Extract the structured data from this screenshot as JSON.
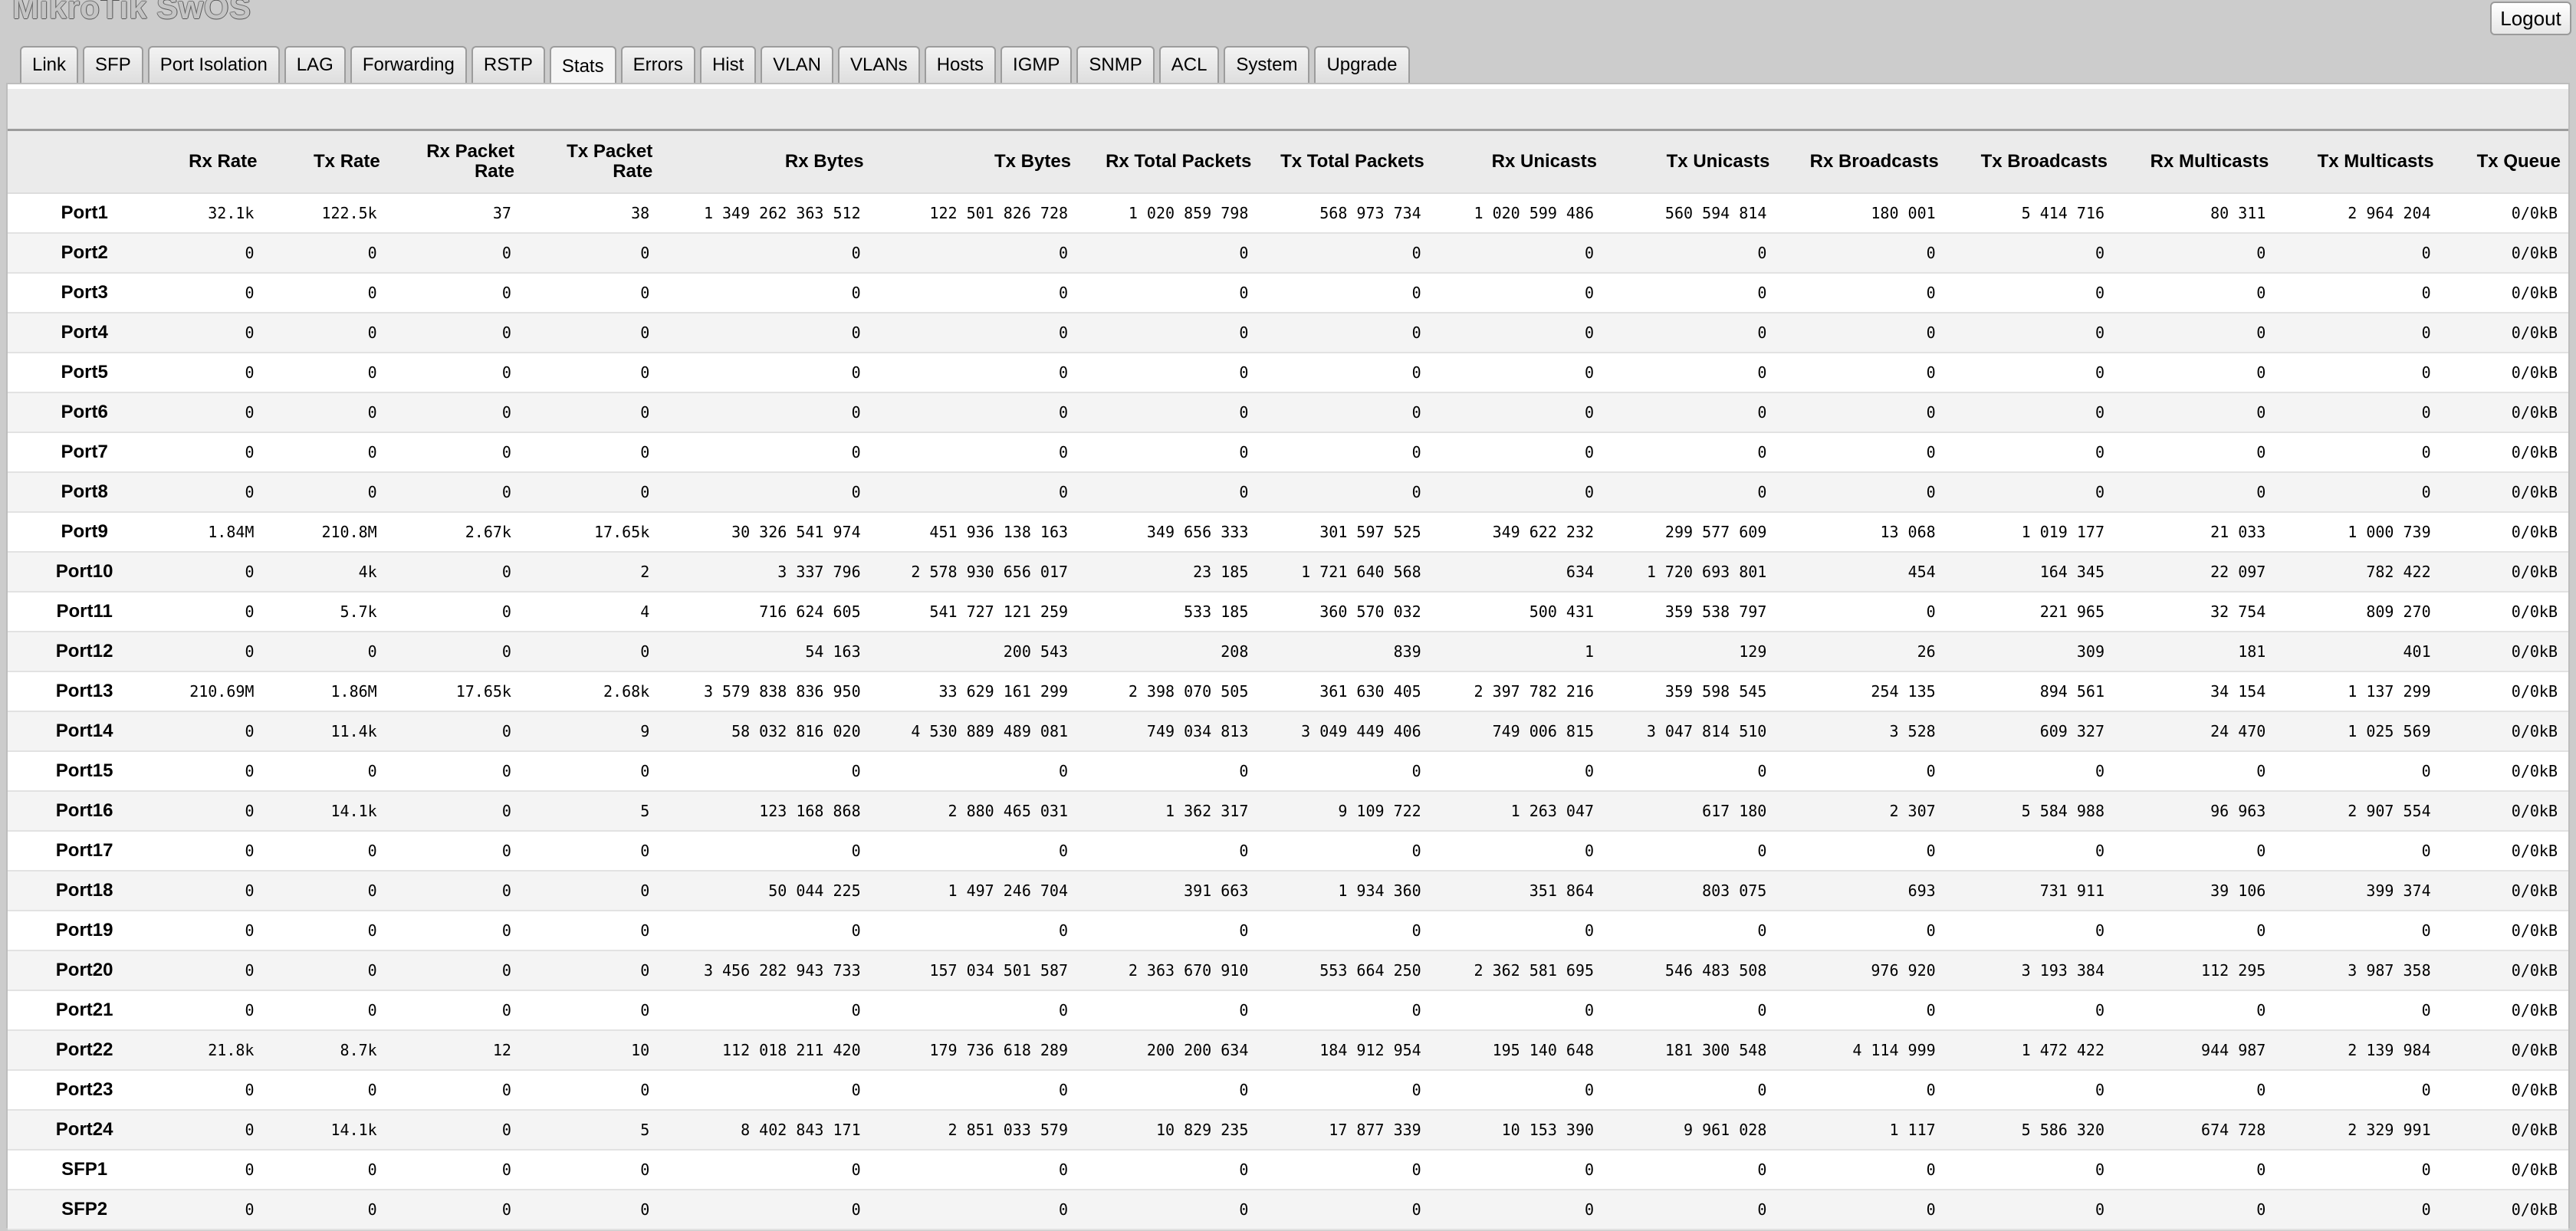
{
  "app": {
    "title": "MikroTik SwOS",
    "logout_label": "Logout"
  },
  "tabs": [
    {
      "label": "Link",
      "active": false
    },
    {
      "label": "SFP",
      "active": false
    },
    {
      "label": "Port Isolation",
      "active": false
    },
    {
      "label": "LAG",
      "active": false
    },
    {
      "label": "Forwarding",
      "active": false
    },
    {
      "label": "RSTP",
      "active": false
    },
    {
      "label": "Stats",
      "active": true
    },
    {
      "label": "Errors",
      "active": false
    },
    {
      "label": "Hist",
      "active": false
    },
    {
      "label": "VLAN",
      "active": false
    },
    {
      "label": "VLANs",
      "active": false
    },
    {
      "label": "Hosts",
      "active": false
    },
    {
      "label": "IGMP",
      "active": false
    },
    {
      "label": "SNMP",
      "active": false
    },
    {
      "label": "ACL",
      "active": false
    },
    {
      "label": "System",
      "active": false
    },
    {
      "label": "Upgrade",
      "active": false
    }
  ],
  "stats": {
    "columns": [
      "",
      "Rx Rate",
      "Tx Rate",
      "Rx Packet Rate",
      "Tx Packet Rate",
      "Rx Bytes",
      "Tx Bytes",
      "Rx Total Packets",
      "Tx Total Packets",
      "Rx Unicasts",
      "Tx Unicasts",
      "Rx Broadcasts",
      "Tx Broadcasts",
      "Rx Multicasts",
      "Tx Multicasts",
      "Tx Queue"
    ],
    "rows": [
      [
        "Port1",
        "32.1k",
        "122.5k",
        "37",
        "38",
        "1 349 262 363 512",
        "122 501 826 728",
        "1 020 859 798",
        "568 973 734",
        "1 020 599 486",
        "560 594 814",
        "180 001",
        "5 414 716",
        "80 311",
        "2 964 204",
        "0/0kB"
      ],
      [
        "Port2",
        "0",
        "0",
        "0",
        "0",
        "0",
        "0",
        "0",
        "0",
        "0",
        "0",
        "0",
        "0",
        "0",
        "0",
        "0/0kB"
      ],
      [
        "Port3",
        "0",
        "0",
        "0",
        "0",
        "0",
        "0",
        "0",
        "0",
        "0",
        "0",
        "0",
        "0",
        "0",
        "0",
        "0/0kB"
      ],
      [
        "Port4",
        "0",
        "0",
        "0",
        "0",
        "0",
        "0",
        "0",
        "0",
        "0",
        "0",
        "0",
        "0",
        "0",
        "0",
        "0/0kB"
      ],
      [
        "Port5",
        "0",
        "0",
        "0",
        "0",
        "0",
        "0",
        "0",
        "0",
        "0",
        "0",
        "0",
        "0",
        "0",
        "0",
        "0/0kB"
      ],
      [
        "Port6",
        "0",
        "0",
        "0",
        "0",
        "0",
        "0",
        "0",
        "0",
        "0",
        "0",
        "0",
        "0",
        "0",
        "0",
        "0/0kB"
      ],
      [
        "Port7",
        "0",
        "0",
        "0",
        "0",
        "0",
        "0",
        "0",
        "0",
        "0",
        "0",
        "0",
        "0",
        "0",
        "0",
        "0/0kB"
      ],
      [
        "Port8",
        "0",
        "0",
        "0",
        "0",
        "0",
        "0",
        "0",
        "0",
        "0",
        "0",
        "0",
        "0",
        "0",
        "0",
        "0/0kB"
      ],
      [
        "Port9",
        "1.84M",
        "210.8M",
        "2.67k",
        "17.65k",
        "30 326 541 974",
        "451 936 138 163",
        "349 656 333",
        "301 597 525",
        "349 622 232",
        "299 577 609",
        "13 068",
        "1 019 177",
        "21 033",
        "1 000 739",
        "0/0kB"
      ],
      [
        "Port10",
        "0",
        "4k",
        "0",
        "2",
        "3 337 796",
        "2 578 930 656 017",
        "23 185",
        "1 721 640 568",
        "634",
        "1 720 693 801",
        "454",
        "164 345",
        "22 097",
        "782 422",
        "0/0kB"
      ],
      [
        "Port11",
        "0",
        "5.7k",
        "0",
        "4",
        "716 624 605",
        "541 727 121 259",
        "533 185",
        "360 570 032",
        "500 431",
        "359 538 797",
        "0",
        "221 965",
        "32 754",
        "809 270",
        "0/0kB"
      ],
      [
        "Port12",
        "0",
        "0",
        "0",
        "0",
        "54 163",
        "200 543",
        "208",
        "839",
        "1",
        "129",
        "26",
        "309",
        "181",
        "401",
        "0/0kB"
      ],
      [
        "Port13",
        "210.69M",
        "1.86M",
        "17.65k",
        "2.68k",
        "3 579 838 836 950",
        "33 629 161 299",
        "2 398 070 505",
        "361 630 405",
        "2 397 782 216",
        "359 598 545",
        "254 135",
        "894 561",
        "34 154",
        "1 137 299",
        "0/0kB"
      ],
      [
        "Port14",
        "0",
        "11.4k",
        "0",
        "9",
        "58 032 816 020",
        "4 530 889 489 081",
        "749 034 813",
        "3 049 449 406",
        "749 006 815",
        "3 047 814 510",
        "3 528",
        "609 327",
        "24 470",
        "1 025 569",
        "0/0kB"
      ],
      [
        "Port15",
        "0",
        "0",
        "0",
        "0",
        "0",
        "0",
        "0",
        "0",
        "0",
        "0",
        "0",
        "0",
        "0",
        "0",
        "0/0kB"
      ],
      [
        "Port16",
        "0",
        "14.1k",
        "0",
        "5",
        "123 168 868",
        "2 880 465 031",
        "1 362 317",
        "9 109 722",
        "1 263 047",
        "617 180",
        "2 307",
        "5 584 988",
        "96 963",
        "2 907 554",
        "0/0kB"
      ],
      [
        "Port17",
        "0",
        "0",
        "0",
        "0",
        "0",
        "0",
        "0",
        "0",
        "0",
        "0",
        "0",
        "0",
        "0",
        "0",
        "0/0kB"
      ],
      [
        "Port18",
        "0",
        "0",
        "0",
        "0",
        "50 044 225",
        "1 497 246 704",
        "391 663",
        "1 934 360",
        "351 864",
        "803 075",
        "693",
        "731 911",
        "39 106",
        "399 374",
        "0/0kB"
      ],
      [
        "Port19",
        "0",
        "0",
        "0",
        "0",
        "0",
        "0",
        "0",
        "0",
        "0",
        "0",
        "0",
        "0",
        "0",
        "0",
        "0/0kB"
      ],
      [
        "Port20",
        "0",
        "0",
        "0",
        "0",
        "3 456 282 943 733",
        "157 034 501 587",
        "2 363 670 910",
        "553 664 250",
        "2 362 581 695",
        "546 483 508",
        "976 920",
        "3 193 384",
        "112 295",
        "3 987 358",
        "0/0kB"
      ],
      [
        "Port21",
        "0",
        "0",
        "0",
        "0",
        "0",
        "0",
        "0",
        "0",
        "0",
        "0",
        "0",
        "0",
        "0",
        "0",
        "0/0kB"
      ],
      [
        "Port22",
        "21.8k",
        "8.7k",
        "12",
        "10",
        "112 018 211 420",
        "179 736 618 289",
        "200 200 634",
        "184 912 954",
        "195 140 648",
        "181 300 548",
        "4 114 999",
        "1 472 422",
        "944 987",
        "2 139 984",
        "0/0kB"
      ],
      [
        "Port23",
        "0",
        "0",
        "0",
        "0",
        "0",
        "0",
        "0",
        "0",
        "0",
        "0",
        "0",
        "0",
        "0",
        "0",
        "0/0kB"
      ],
      [
        "Port24",
        "0",
        "14.1k",
        "0",
        "5",
        "8 402 843 171",
        "2 851 033 579",
        "10 829 235",
        "17 877 339",
        "10 153 390",
        "9 961 028",
        "1 117",
        "5 586 320",
        "674 728",
        "2 329 991",
        "0/0kB"
      ],
      [
        "SFP1",
        "0",
        "0",
        "0",
        "0",
        "0",
        "0",
        "0",
        "0",
        "0",
        "0",
        "0",
        "0",
        "0",
        "0",
        "0/0kB"
      ],
      [
        "SFP2",
        "0",
        "0",
        "0",
        "0",
        "0",
        "0",
        "0",
        "0",
        "0",
        "0",
        "0",
        "0",
        "0",
        "0",
        "0/0kB"
      ]
    ]
  }
}
